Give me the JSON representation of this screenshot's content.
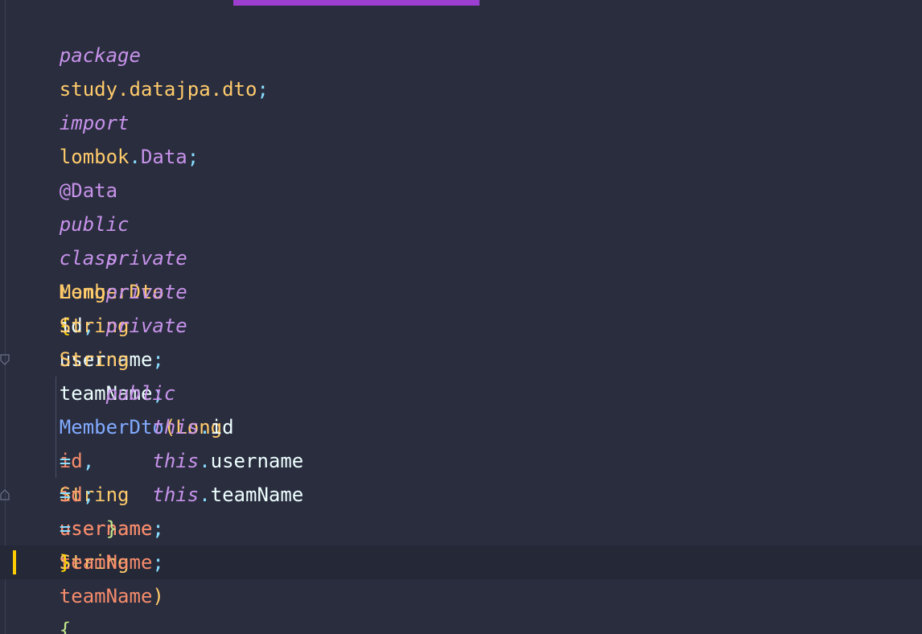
{
  "colors": {
    "background": "#292d3e",
    "keyword": "#c792ea",
    "type": "#ffcb6b",
    "field": "#eeffff",
    "parameter": "#f78c6c",
    "method": "#82aaff",
    "punctuation": "#89ddff",
    "caret": "#ffcc00",
    "tab_indicator": "#9c3fd1"
  },
  "code": {
    "line1": {
      "kw": "package",
      "name": "study.datajpa.dto",
      "semi": ";"
    },
    "line3": {
      "kw": "import",
      "pkg": "lombok",
      "dot": ".",
      "cls": "Data",
      "semi": ";"
    },
    "line5": {
      "annotation": "@Data"
    },
    "line6": {
      "kw1": "public",
      "kw2": "class",
      "name": "MemberDto",
      "brace": "{"
    },
    "line7": {
      "kw": "private",
      "type": "Long",
      "name": "id",
      "semi": ";"
    },
    "line8": {
      "kw": "private",
      "type": "String",
      "name": "username",
      "semi": ";"
    },
    "line9": {
      "kw": "private",
      "type": "String",
      "name": "teamName",
      "semi": ";"
    },
    "line11": {
      "kw": "public",
      "method": "MemberDto",
      "open_paren": "(",
      "t1": "Long",
      "p1": "id",
      "comma1": ",",
      "t2": "String",
      "p2": "username",
      "comma2": ",",
      "t3": "String",
      "p3": "teamName",
      "close_paren": ")",
      "brace": "{"
    },
    "line12": {
      "kw": "this",
      "dot": ".",
      "field": "id",
      "eq": "=",
      "val": "id",
      "semi": ";"
    },
    "line13": {
      "kw": "this",
      "dot": ".",
      "field": "username",
      "eq": "=",
      "val": "username",
      "semi": ";"
    },
    "line14": {
      "kw": "this",
      "dot": ".",
      "field": "teamName",
      "eq": "=",
      "val": "teamName",
      "semi": ";"
    },
    "line15": {
      "brace": "}"
    },
    "line16": {
      "brace": "}"
    }
  }
}
